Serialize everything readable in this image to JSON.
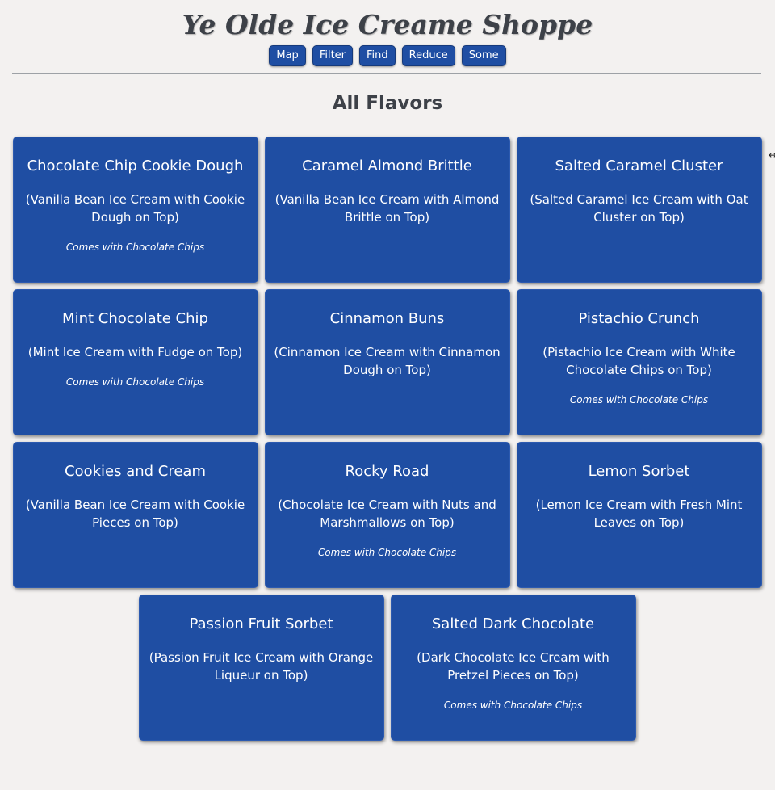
{
  "app": {
    "title": "Ye Olde Ice Creame Shoppe"
  },
  "nav": {
    "buttons": [
      "Map",
      "Filter",
      "Find",
      "Reduce",
      "Some"
    ]
  },
  "section": {
    "title": "All Flavors"
  },
  "flavors": [
    {
      "name": "Chocolate Chip Cookie Dough",
      "description": "(Vanilla Bean Ice Cream with Cookie Dough on Top)",
      "extra": "Comes with Chocolate Chips"
    },
    {
      "name": "Caramel Almond Brittle",
      "description": "(Vanilla Bean Ice Cream with Almond Brittle on Top)",
      "extra": ""
    },
    {
      "name": "Salted Caramel Cluster",
      "description": "(Salted Caramel Ice Cream with Oat Cluster on Top)",
      "extra": ""
    },
    {
      "name": "Mint Chocolate Chip",
      "description": "(Mint Ice Cream with Fudge on Top)",
      "extra": "Comes with Chocolate Chips"
    },
    {
      "name": "Cinnamon Buns",
      "description": "(Cinnamon Ice Cream with Cinnamon Dough on Top)",
      "extra": ""
    },
    {
      "name": "Pistachio Crunch",
      "description": "(Pistachio Ice Cream with White Chocolate Chips on Top)",
      "extra": "Comes with Chocolate Chips"
    },
    {
      "name": "Cookies and Cream",
      "description": "(Vanilla Bean Ice Cream with Cookie Pieces on Top)",
      "extra": ""
    },
    {
      "name": "Rocky Road",
      "description": "(Chocolate Ice Cream with Nuts and Marshmallows on Top)",
      "extra": "Comes with Chocolate Chips"
    },
    {
      "name": "Lemon Sorbet",
      "description": "(Lemon Ice Cream with Fresh Mint Leaves on Top)",
      "extra": ""
    },
    {
      "name": "Passion Fruit Sorbet",
      "description": "(Passion Fruit Ice Cream with Orange Liqueur on Top)",
      "extra": ""
    },
    {
      "name": "Salted Dark Chocolate",
      "description": "(Dark Chocolate Ice Cream with Pretzel Pieces on Top)",
      "extra": "Comes with Chocolate Chips"
    }
  ],
  "colors": {
    "background": "#f3f1f0",
    "card": "#1f4ea3",
    "button": "#1f4ea3",
    "title_text": "#3d4148",
    "card_text": "#ffffff"
  },
  "cursor_icon": "resize-cursor-icon"
}
